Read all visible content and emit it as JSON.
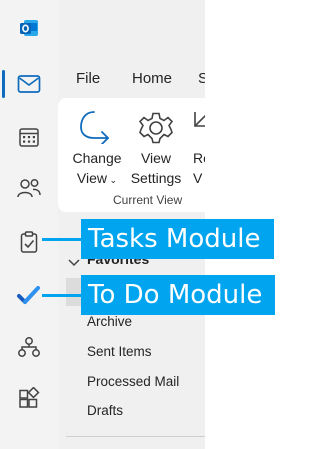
{
  "app": {
    "name": "Outlook",
    "icon": "outlook-logo-icon"
  },
  "nav_rail": {
    "items": [
      {
        "name": "mail",
        "icon": "mail-icon",
        "active": true
      },
      {
        "name": "calendar",
        "icon": "calendar-icon"
      },
      {
        "name": "people",
        "icon": "people-icon"
      },
      {
        "name": "tasks",
        "icon": "clipboard-check-icon"
      },
      {
        "name": "to-do",
        "icon": "todo-check-icon"
      },
      {
        "name": "groups",
        "icon": "org-icon"
      },
      {
        "name": "apps",
        "icon": "apps-icon"
      }
    ]
  },
  "menu": {
    "tabs": [
      "File",
      "Home",
      "S"
    ]
  },
  "ribbon": {
    "change_view": {
      "line1": "Change",
      "line2": "View"
    },
    "view_settings": {
      "line1": "View",
      "line2": "Settings"
    },
    "reset_view": {
      "line1": "Re",
      "line2": "V"
    },
    "group_label": "Current View"
  },
  "folders": {
    "favorites_label": "Favorites",
    "items": [
      "Archive",
      "Sent Items",
      "Processed Mail",
      "Drafts"
    ]
  },
  "callouts": {
    "tasks": "Tasks Module",
    "todo": "To Do Module"
  },
  "colors": {
    "accent": "#0f6cbd",
    "callout": "#00a4ef"
  }
}
